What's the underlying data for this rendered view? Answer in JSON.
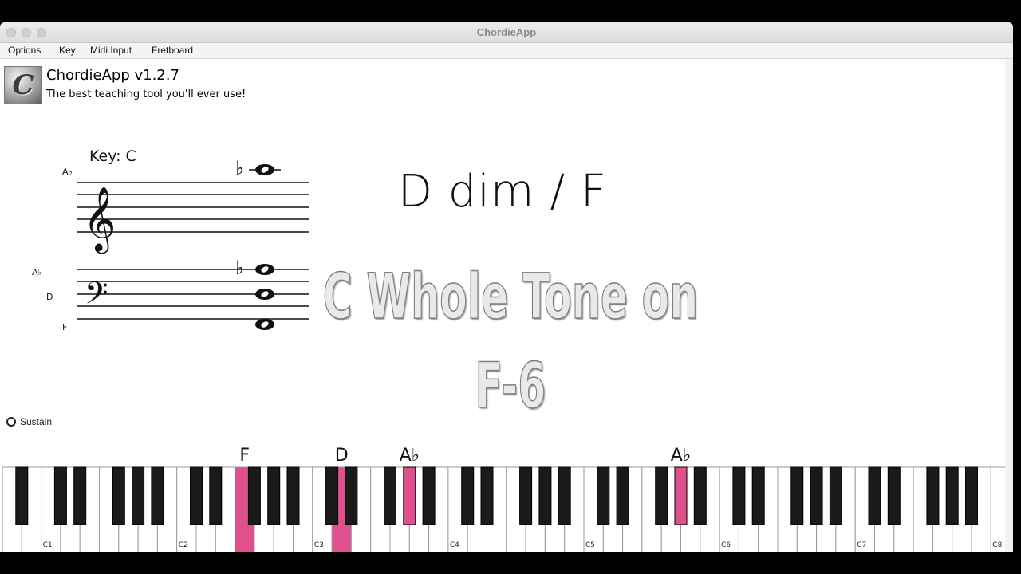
{
  "window": {
    "title": "ChordieApp"
  },
  "menu": [
    "Options",
    "Key",
    "Midi Input",
    "Fretboard"
  ],
  "header": {
    "logo_letter": "C",
    "app_name": "ChordieApp v1.2.7",
    "tagline": "The best teaching tool you'll ever use!"
  },
  "staff": {
    "key_label": "Key: C",
    "treble_note_label": "A♭",
    "bass_note_labels": [
      "A♭",
      "D",
      "F"
    ]
  },
  "chord": {
    "name": "D dim / F"
  },
  "scale": {
    "line1": "C Whole Tone on",
    "line2": "F-6"
  },
  "sustain": {
    "label": "Sustain",
    "checked": false
  },
  "keyboard": {
    "octave_labels": [
      "C1",
      "C2",
      "C3",
      "C4",
      "C5",
      "C6",
      "C7",
      "C8"
    ],
    "key_labels": [
      {
        "note": "F",
        "text": "F"
      },
      {
        "note": "D",
        "text": "D"
      },
      {
        "note": "Ab3",
        "text": "A♭"
      },
      {
        "note": "Ab5",
        "text": "A♭"
      }
    ],
    "highlight_color": "#e0508f"
  }
}
